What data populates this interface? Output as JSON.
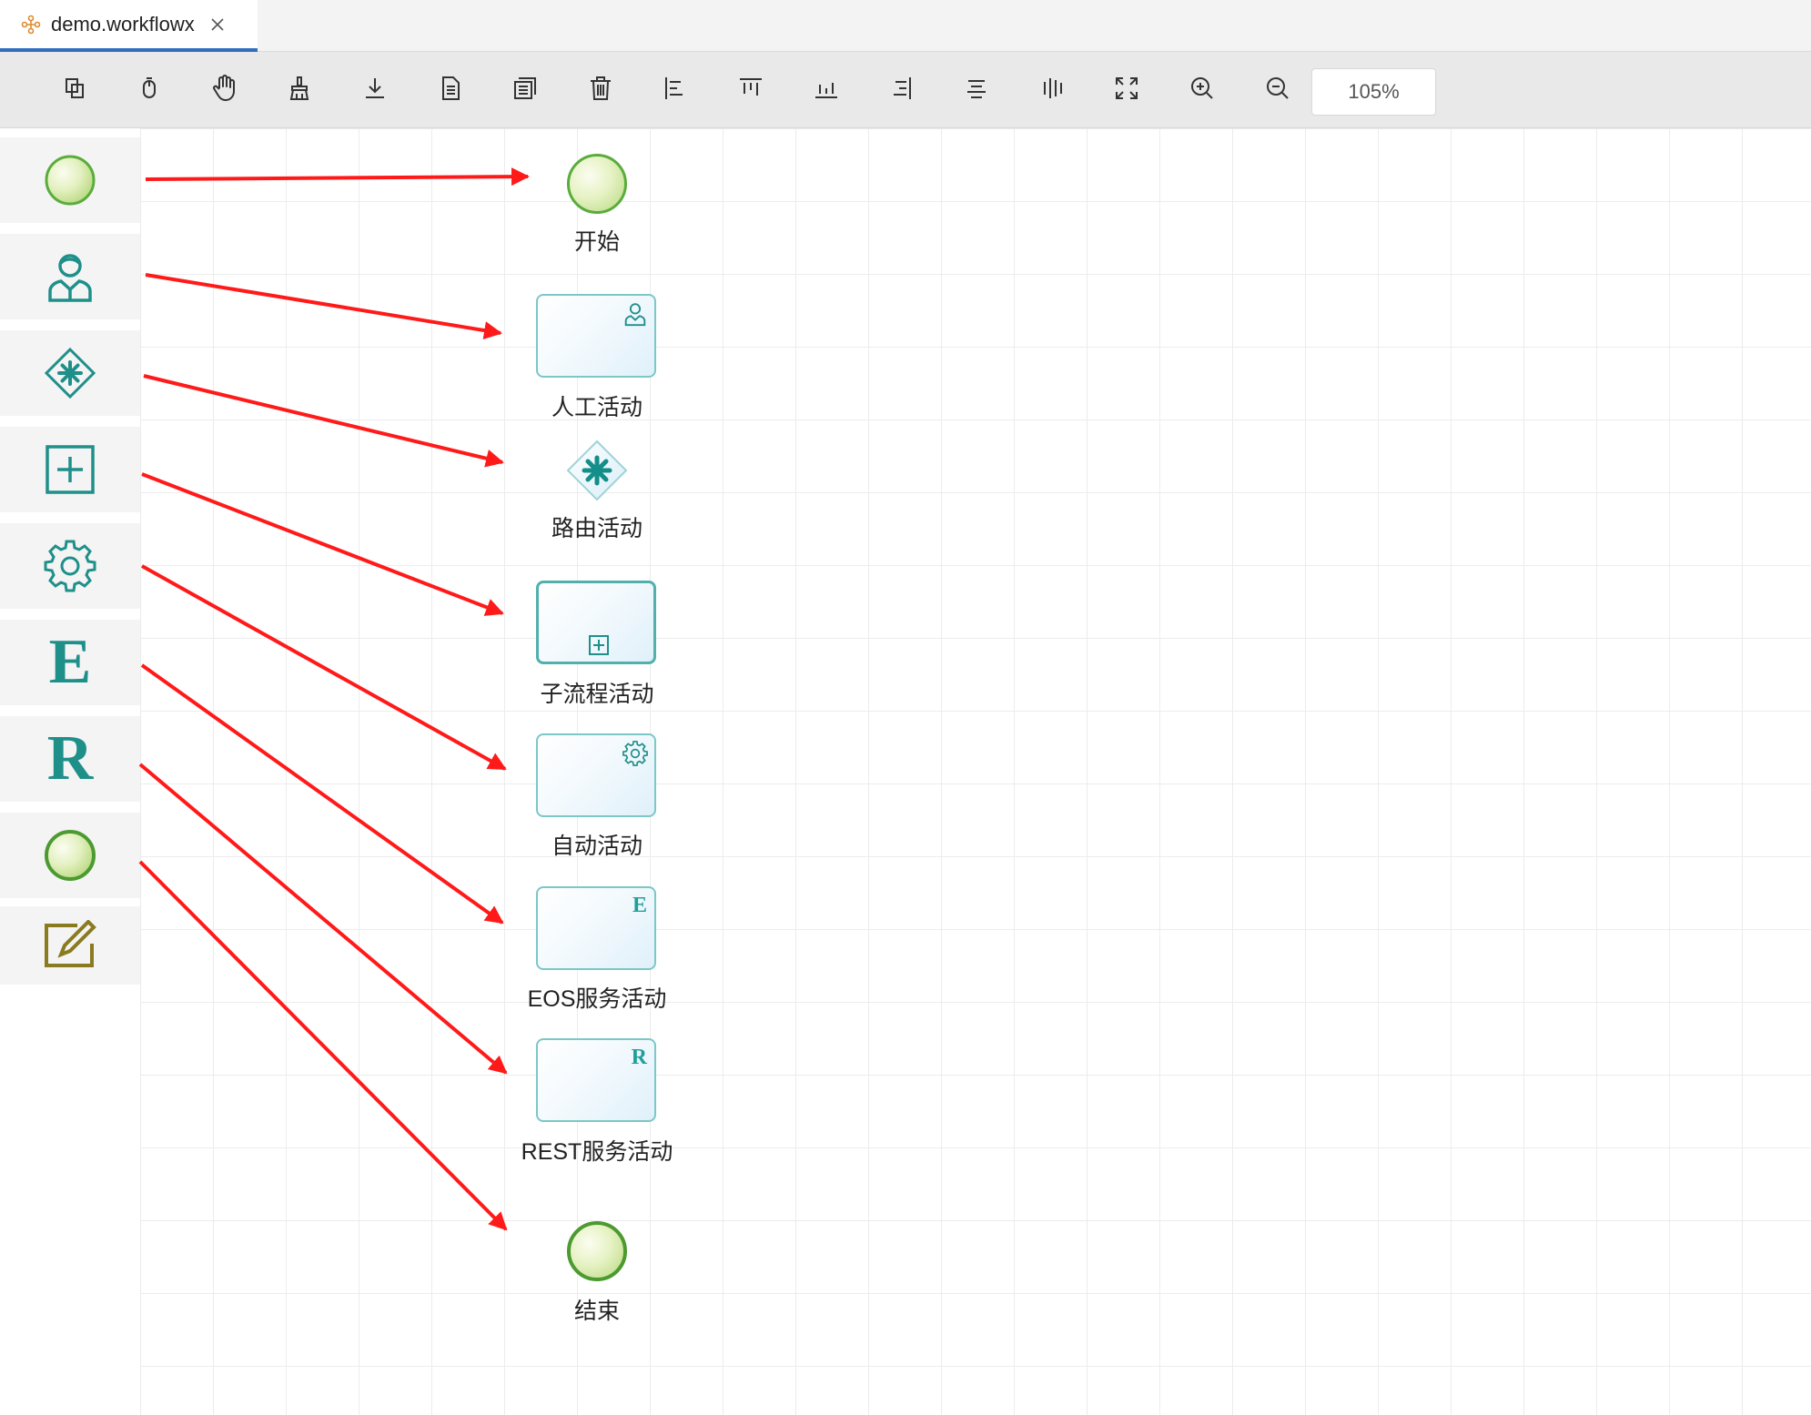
{
  "tab": {
    "title": "demo.workflowx",
    "icon": "workflow-file-icon",
    "close_icon": "close-icon"
  },
  "toolbar": {
    "buttons": [
      "copy-icon",
      "select-icon",
      "pan-hand-icon",
      "clear-icon",
      "download-icon",
      "document-icon",
      "properties-icon",
      "delete-icon",
      "align-left-icon",
      "align-top-icon",
      "align-bottom-icon",
      "align-right-icon",
      "align-center-icon",
      "align-middle-icon",
      "fit-screen-icon",
      "zoom-in-icon",
      "zoom-out-icon"
    ],
    "zoom": "105%"
  },
  "palette": {
    "items": [
      "start-event-tool",
      "manual-activity-tool",
      "route-activity-tool",
      "subprocess-activity-tool",
      "auto-activity-tool",
      "eos-service-tool",
      "rest-service-tool",
      "end-event-tool",
      "note-tool"
    ],
    "eos_letter": "E",
    "rest_letter": "R"
  },
  "nodes": {
    "start": "开始",
    "manual": "人工活动",
    "route": "路由活动",
    "subprocess": "子流程活动",
    "auto": "自动活动",
    "eos": "EOS服务活动",
    "eos_mark": "E",
    "rest": "REST服务活动",
    "rest_mark": "R",
    "end": "结束"
  },
  "colors": {
    "accent": "#1f8f8a",
    "arrow": "#ff1a1a",
    "event_border": "#5aac3c",
    "tab_active": "#2f6fbd"
  }
}
